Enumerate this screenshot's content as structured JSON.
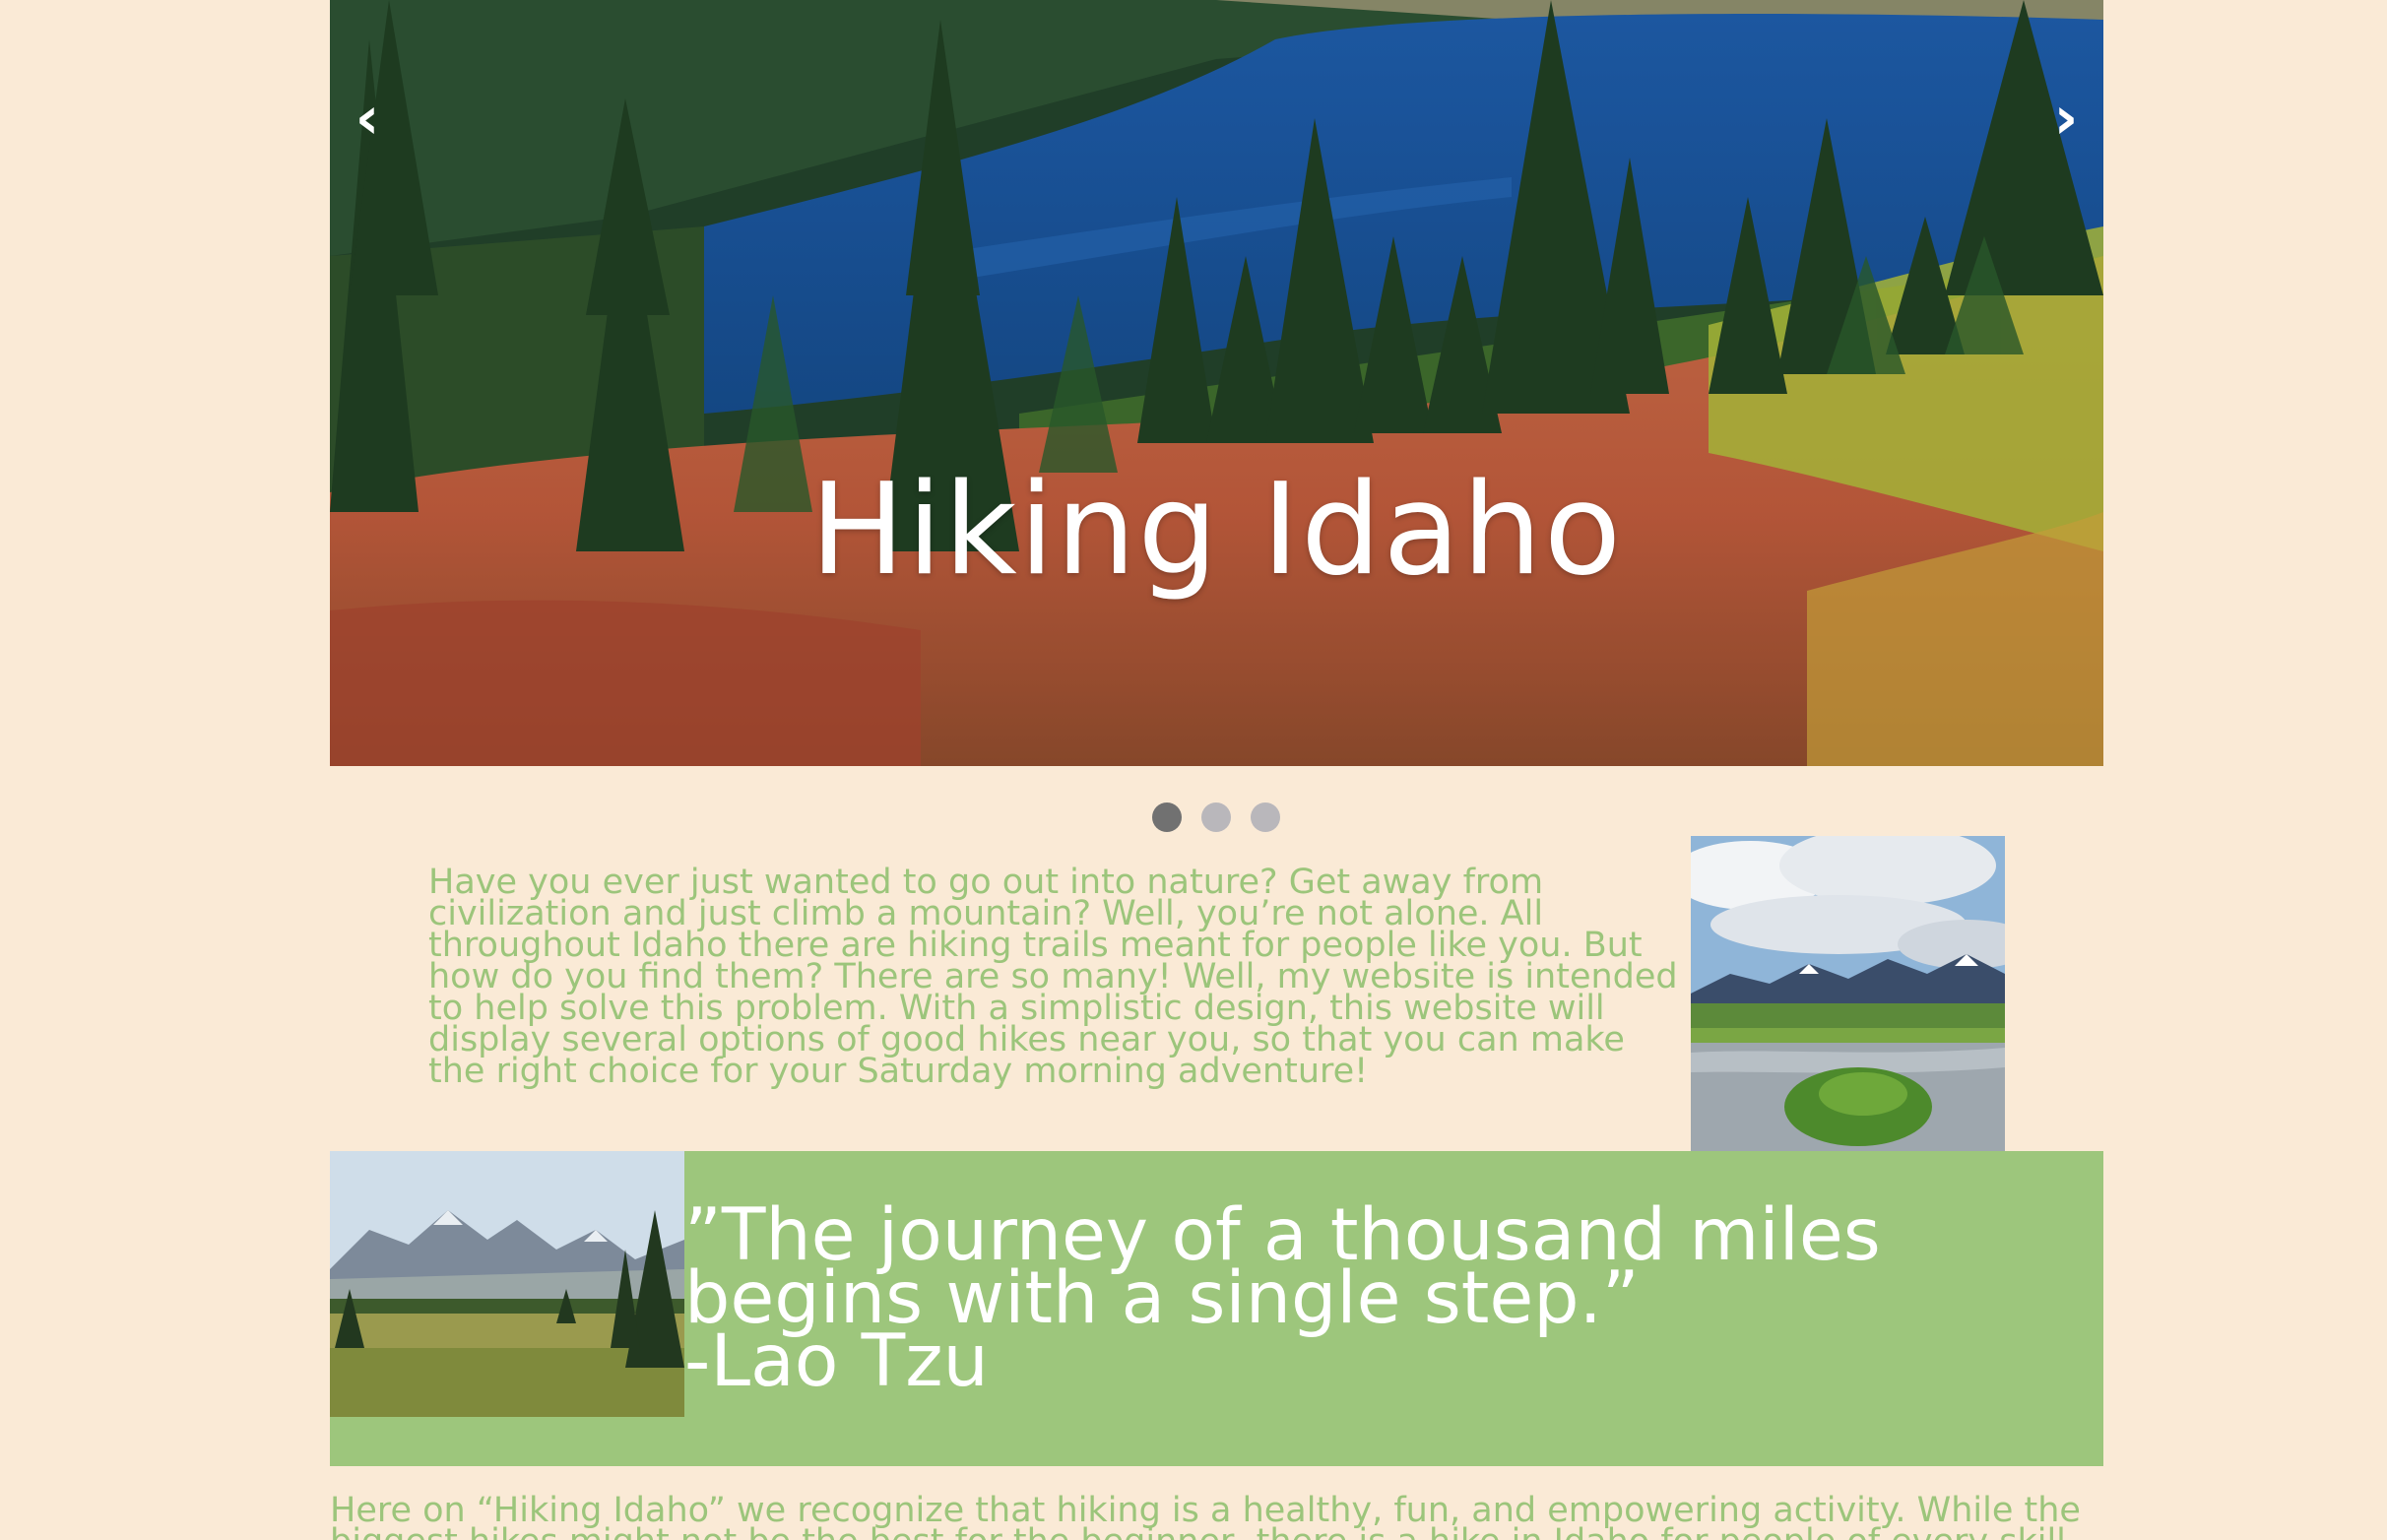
{
  "hero": {
    "title": "Hiking Idaho",
    "prev_label": "‹",
    "next_label": "›",
    "image_icon": "mountain-lake-photo",
    "slide_count": 3,
    "active_slide": 1
  },
  "intro": {
    "paragraph": "Have you ever just wanted to go out into nature? Get away from civilization and just climb a mountain? Well, you’re not alone. All throughout Idaho there are hiking trails meant for people like you. But how do you find them? There are so many! Well, my website is intended to help solve this problem. With a simplistic design, this website will display several options of good hikes near you, so that you can make the right choice for your Saturday morning adventure!",
    "image_icon": "river-mountains-photo"
  },
  "quote": {
    "text": "”The journey of a thousand miles begins with a single step.”",
    "author": "-Lao Tzu",
    "image_icon": "meadow-peaks-photo"
  },
  "bottom": {
    "paragraph_line1": "Here on “Hiking Idaho” we recognize that hiking is a healthy, fun, and empowering activity. While the",
    "paragraph_line2": "biggest hikes might not be the best for the beginner, there is a hike in Idaho for people of every skill"
  },
  "colors": {
    "background": "#faead6",
    "accent_green": "#9dc67c",
    "text_green": "#9cc57b",
    "dot_active": "#717171",
    "dot_inactive": "#b9b7bb"
  }
}
